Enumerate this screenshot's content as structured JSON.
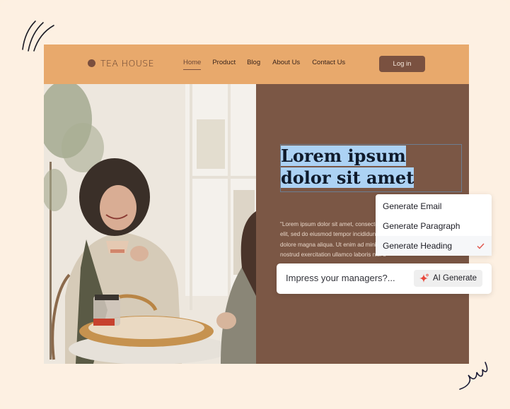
{
  "site": {
    "brand": "TEA HOUSE",
    "nav": [
      {
        "label": "Home",
        "active": true
      },
      {
        "label": "Product",
        "active": false
      },
      {
        "label": "Blog",
        "active": false
      },
      {
        "label": "About Us",
        "active": false
      },
      {
        "label": "Contact Us",
        "active": false
      }
    ],
    "login_label": "Log in",
    "hero": {
      "heading_line1": "Lorem ipsum",
      "heading_line2": "dolor sit amet",
      "body_lines": [
        "\"Lorem ipsum dolor sit amet, consectetur adipiscing",
        "elit, sed do eiusmod tempor incididunt ut labore et",
        "dolore magna aliqua. Ut enim ad minim veniam, quis",
        "nostrud exercitation ullamco laboris nisi ut aliquip"
      ],
      "photo_alt": "woman-drinking-tea-at-cafe-table"
    }
  },
  "ai_menu": {
    "items": [
      {
        "label": "Generate Email",
        "selected": false
      },
      {
        "label": "Generate Paragraph",
        "selected": false
      },
      {
        "label": "Generate Heading",
        "selected": true
      }
    ],
    "check_icon": "checkmark-icon"
  },
  "ai_bar": {
    "input_value": "Impress your managers?...",
    "button_label": "AI Generate",
    "button_icon": "sparkle-icon"
  },
  "colors": {
    "page_bg": "#fdf0e2",
    "nav_bg": "#e8a96c",
    "panel_bg": "#7b5745",
    "button_bg": "#7a5140",
    "selection": "#acd2f4",
    "accent_red": "#e0534a"
  }
}
